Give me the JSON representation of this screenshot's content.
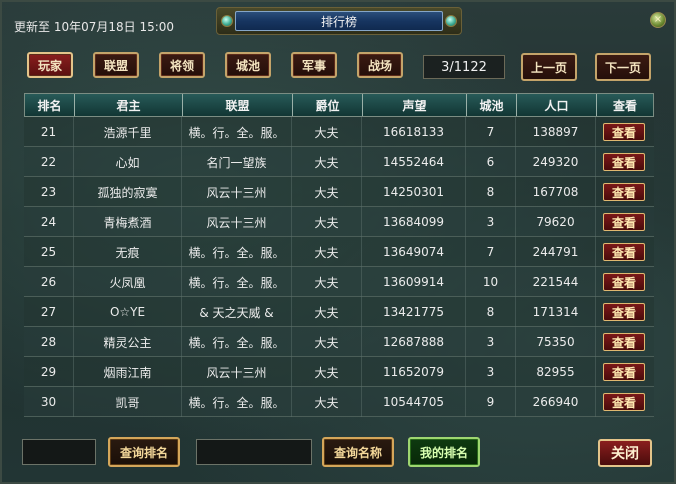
{
  "window": {
    "title": "排行榜",
    "updated_text": "更新至 10年07月18日 15:00",
    "close_glyph": "×"
  },
  "tabs": [
    {
      "label": "玩家",
      "active": true
    },
    {
      "label": "联盟",
      "active": false
    },
    {
      "label": "将领",
      "active": false
    },
    {
      "label": "城池",
      "active": false
    },
    {
      "label": "军事",
      "active": false
    },
    {
      "label": "战场",
      "active": false
    }
  ],
  "pager": {
    "page_text": "3/1122",
    "prev_label": "上一页",
    "next_label": "下一页"
  },
  "table": {
    "headers": [
      "排名",
      "君主",
      "联盟",
      "爵位",
      "声望",
      "城池",
      "人口",
      "查看"
    ],
    "view_label": "查看",
    "rows": [
      [
        "21",
        "浩源千里",
        "横。行。全。服。",
        "大夫",
        "16618133",
        "7",
        "138897"
      ],
      [
        "22",
        "心如",
        "名门一望族",
        "大夫",
        "14552464",
        "6",
        "249320"
      ],
      [
        "23",
        "孤独的寂寞",
        "风云十三州",
        "大夫",
        "14250301",
        "8",
        "167708"
      ],
      [
        "24",
        "青梅煮酒",
        "风云十三州",
        "大夫",
        "13684099",
        "3",
        "79620"
      ],
      [
        "25",
        "无痕",
        "横。行。全。服。",
        "大夫",
        "13649074",
        "7",
        "244791"
      ],
      [
        "26",
        "火凤凰",
        "横。行。全。服。",
        "大夫",
        "13609914",
        "10",
        "221544"
      ],
      [
        "27",
        "O☆YE",
        "& 天之天威 &",
        "大夫",
        "13421775",
        "8",
        "171314"
      ],
      [
        "28",
        "精灵公主",
        "横。行。全。服。",
        "大夫",
        "12687888",
        "3",
        "75350"
      ],
      [
        "29",
        "烟雨江南",
        "风云十三州",
        "大夫",
        "11652079",
        "3",
        "82955"
      ],
      [
        "30",
        "凯哥",
        "横。行。全。服。",
        "大夫",
        "10544705",
        "9",
        "266940"
      ]
    ]
  },
  "bottom": {
    "rank_input_value": "",
    "query_rank_label": "查询排名",
    "name_input_value": "",
    "query_name_label": "查询名称",
    "my_rank_label": "我的排名",
    "close_label": "关闭"
  },
  "colors": {
    "accent_red": "#8a1e1e",
    "gold_border": "#c4a46a",
    "green_button": "#9ed670"
  }
}
